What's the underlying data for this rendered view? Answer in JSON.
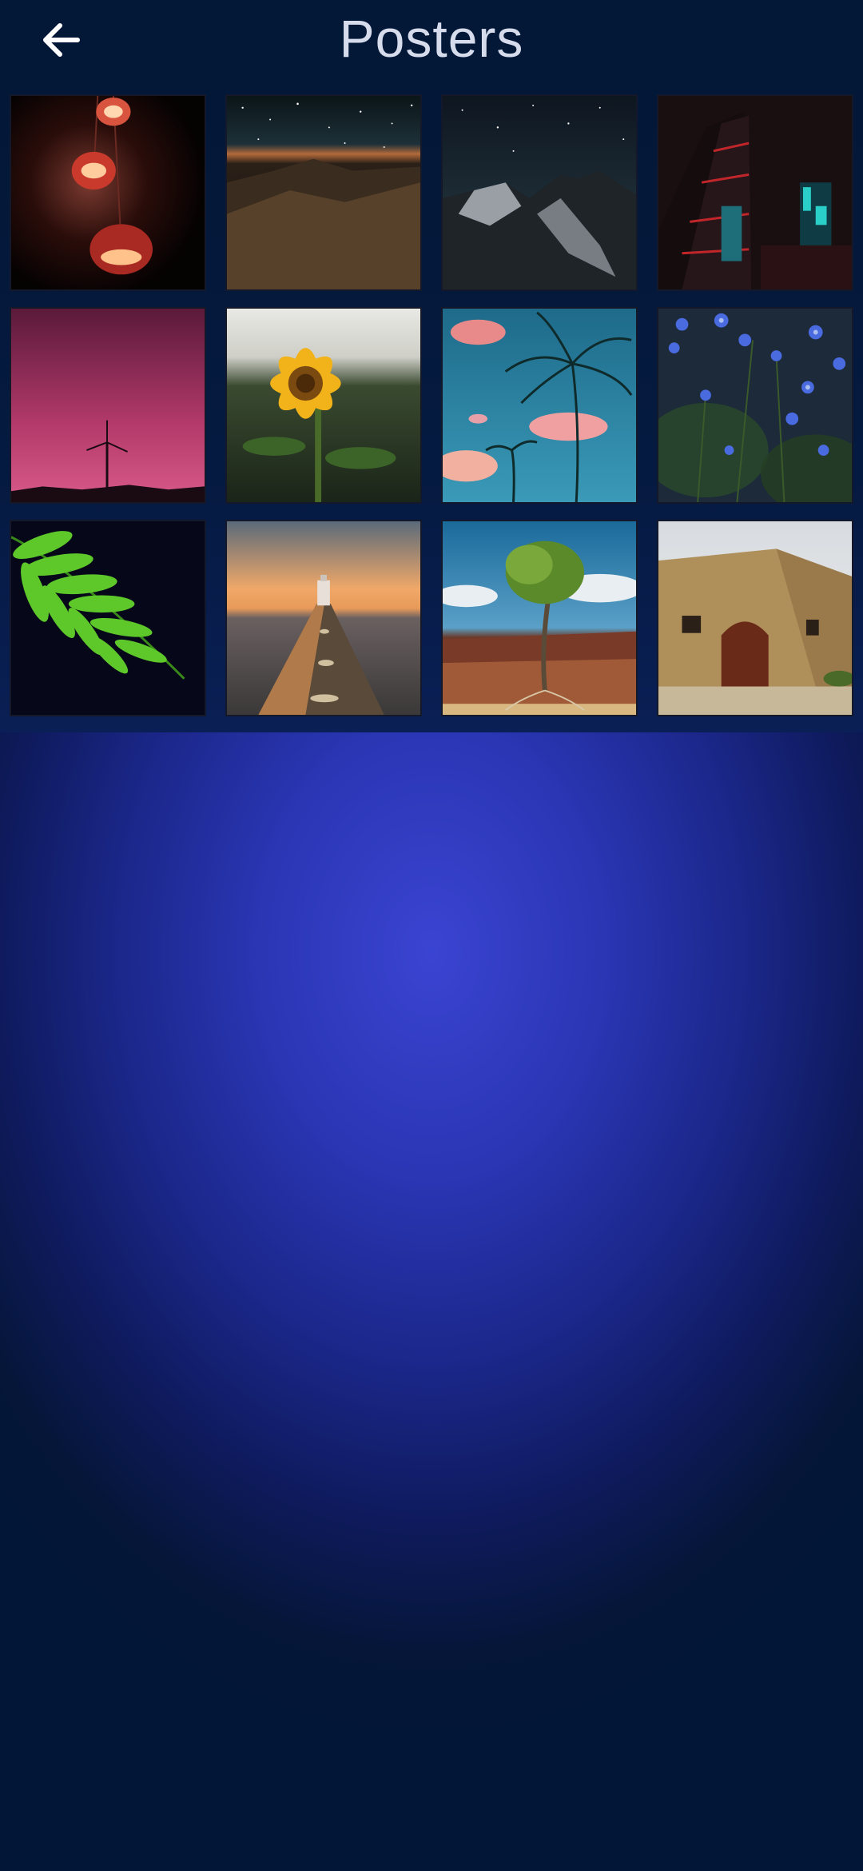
{
  "header": {
    "title": "Posters",
    "back_icon": "arrow-left-icon"
  },
  "posters": [
    {
      "subject": "red-lanterns"
    },
    {
      "subject": "starry-mountain-night"
    },
    {
      "subject": "snowy-mountain-night"
    },
    {
      "subject": "city-towers-night"
    },
    {
      "subject": "pink-sky-windmill"
    },
    {
      "subject": "sunflower"
    },
    {
      "subject": "palm-trees-pink-clouds"
    },
    {
      "subject": "blue-flowers"
    },
    {
      "subject": "green-fern"
    },
    {
      "subject": "lighthouse-pier"
    },
    {
      "subject": "tree-canyon"
    },
    {
      "subject": "stone-doorway"
    }
  ],
  "colors": {
    "header_bg": "#031737",
    "title_text": "#d6dcec",
    "gradient_center": "#3a44d2"
  }
}
